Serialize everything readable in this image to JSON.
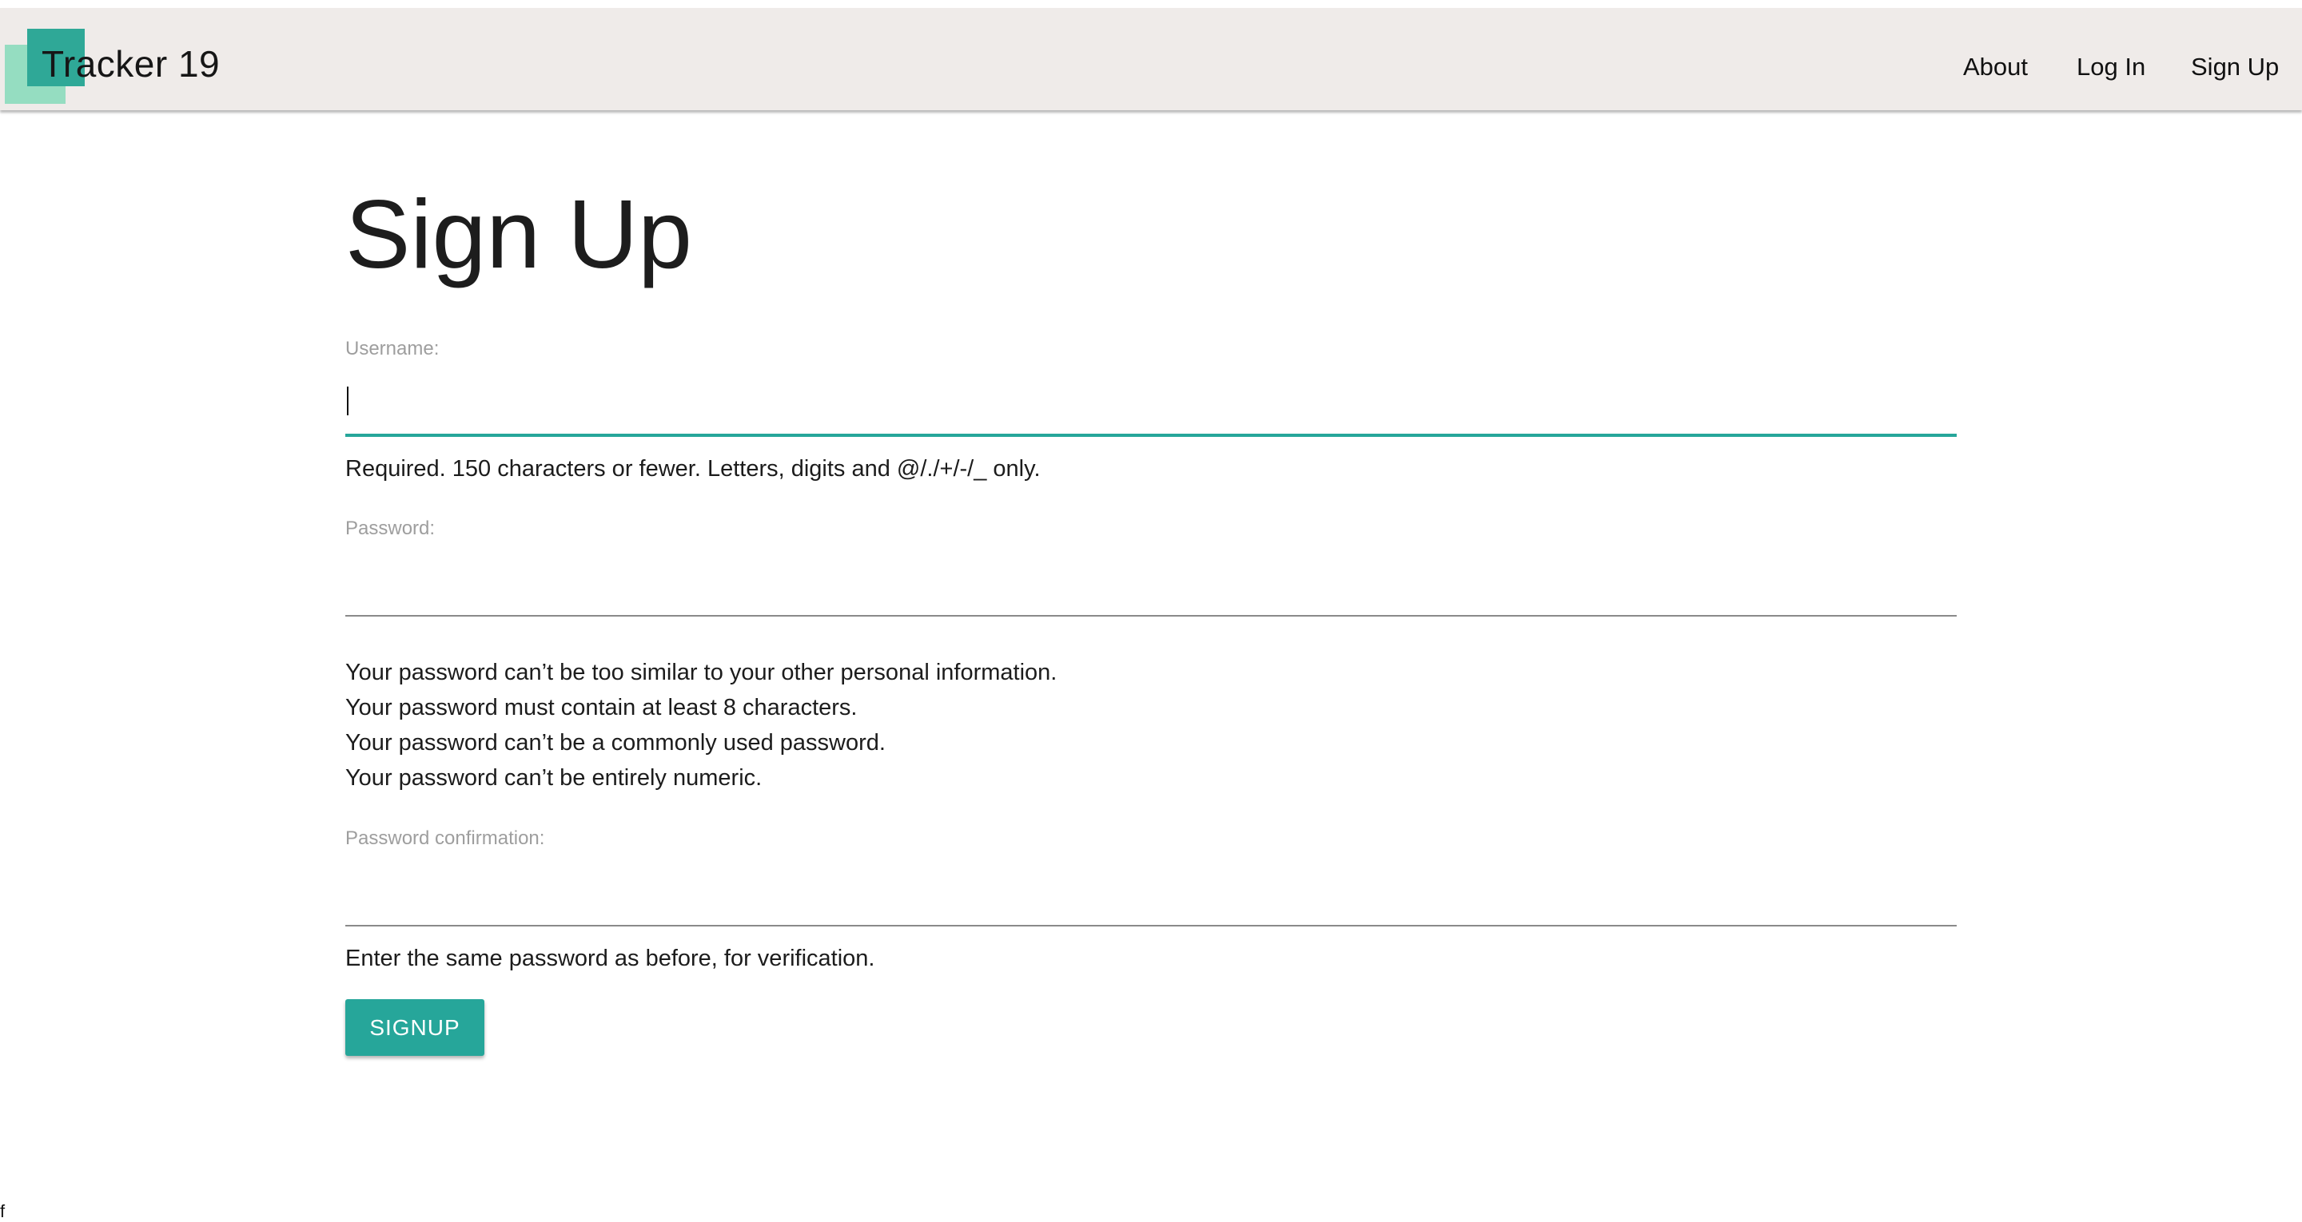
{
  "navbar": {
    "brand": "Tracker 19",
    "links": [
      "About",
      "Log In",
      "Sign Up"
    ]
  },
  "page": {
    "title": "Sign Up"
  },
  "form": {
    "username": {
      "label": "Username:",
      "value": "",
      "help": "Required. 150 characters or fewer. Letters, digits and @/./+/-/_ only."
    },
    "password": {
      "label": "Password:",
      "value": "",
      "help": [
        "Your password can’t be too similar to your other personal information.",
        "Your password must contain at least 8 characters.",
        "Your password can’t be a commonly used password.",
        "Your password can’t be entirely numeric."
      ]
    },
    "password_confirmation": {
      "label": "Password confirmation:",
      "value": "",
      "help": "Enter the same password as before, for verification."
    },
    "submit_label": "SIGNUP"
  },
  "footer": {
    "stray_text": "f"
  },
  "colors": {
    "accent": "#26a69a",
    "navbar_bg": "#efebe9",
    "logo_front": "#2fa897",
    "logo_back": "#8fdcbf"
  }
}
